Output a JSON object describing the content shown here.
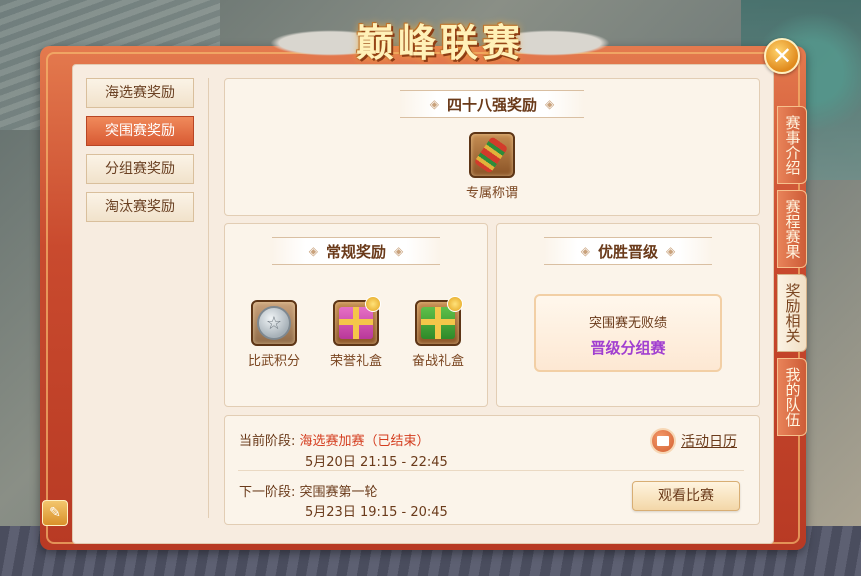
{
  "title": "巅峰联赛",
  "close_icon": "close-icon",
  "left_nav": [
    {
      "label": "海选赛奖励",
      "active": false
    },
    {
      "label": "突围赛奖励",
      "active": true
    },
    {
      "label": "分组赛奖励",
      "active": false
    },
    {
      "label": "淘汰赛奖励",
      "active": false
    }
  ],
  "right_tabs": [
    {
      "label": "赛事介绍",
      "active": false
    },
    {
      "label": "赛程赛果",
      "active": false
    },
    {
      "label": "奖励相关",
      "active": true
    },
    {
      "label": "我的队伍",
      "active": false
    }
  ],
  "top40": {
    "title": "四十八强奖励",
    "rewards": [
      {
        "label": "专属称谓",
        "icon": "scroll-icon"
      }
    ]
  },
  "regular": {
    "title": "常规奖励",
    "rewards": [
      {
        "label": "比武积分",
        "icon": "coin-icon"
      },
      {
        "label": "荣誉礼盒",
        "icon": "gift-box-icon"
      },
      {
        "label": "奋战礼盒",
        "icon": "gift-box-icon"
      }
    ]
  },
  "promotion": {
    "title": "优胜晋级",
    "condition": "突围赛无败绩",
    "result": "晋级分组赛"
  },
  "schedule": {
    "current_label": "当前阶段:",
    "current_value": "海选赛加赛（已结束）",
    "current_time": "5月20日  21:15 - 22:45",
    "next_label": "下一阶段:",
    "next_value": "突围赛第一轮",
    "next_time": "5月23日  19:15 - 20:45",
    "calendar_label": "活动日历",
    "watch_label": "观看比赛"
  }
}
